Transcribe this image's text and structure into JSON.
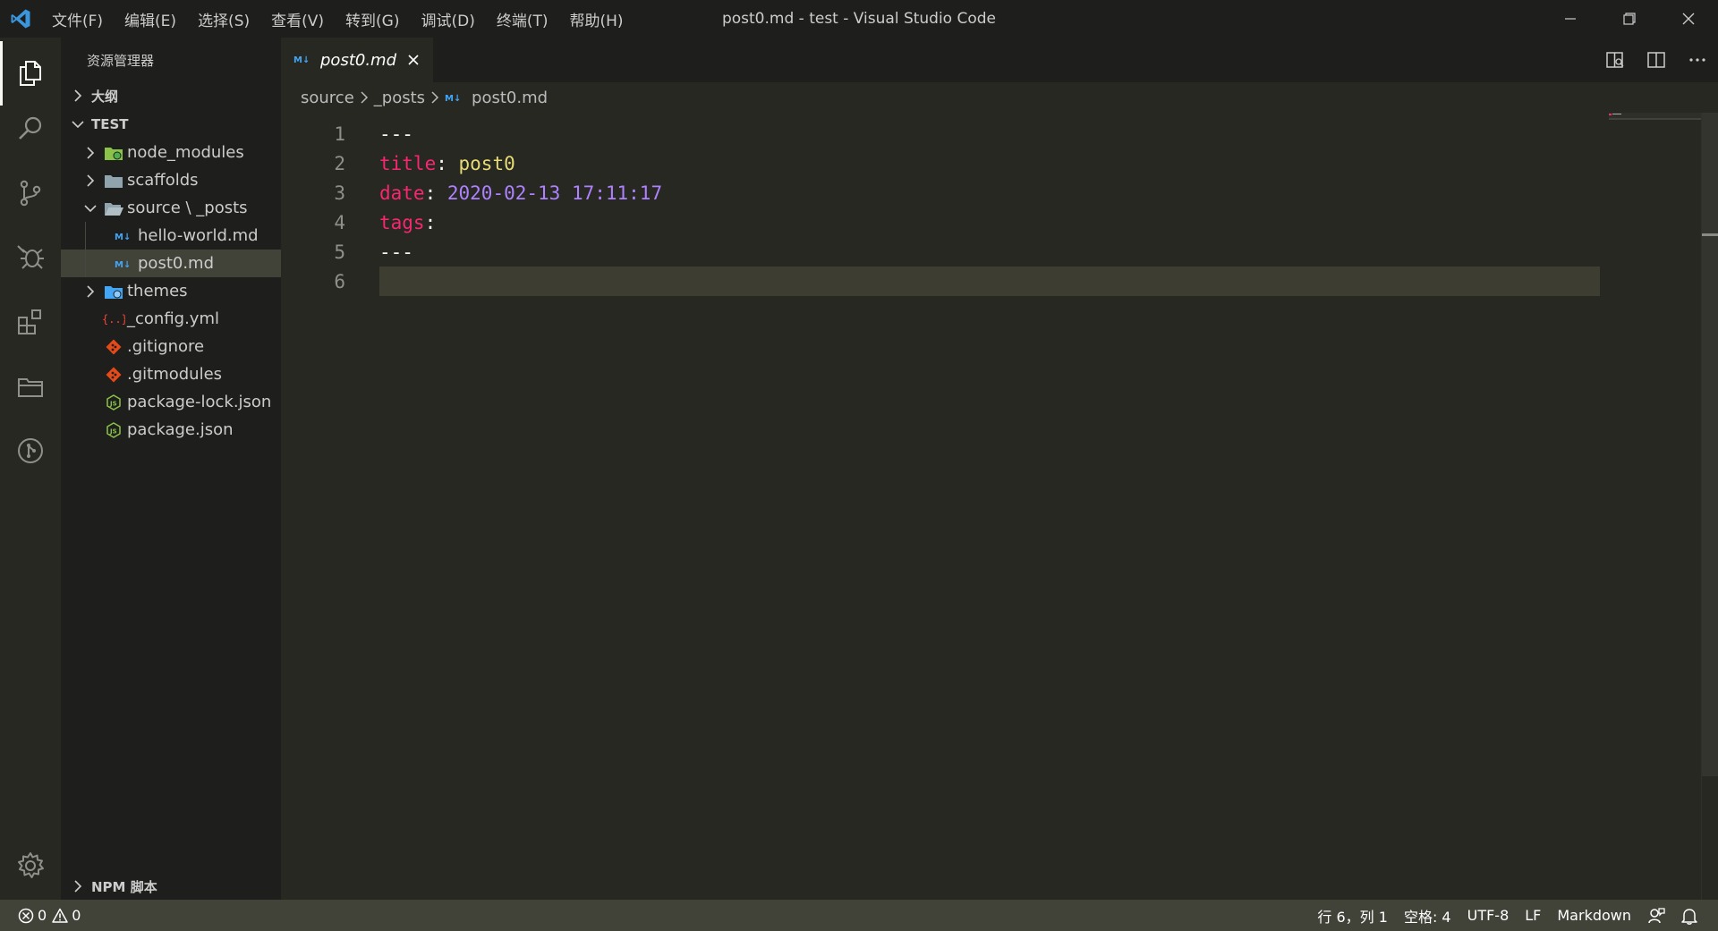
{
  "titlebar": {
    "menu": [
      "文件(F)",
      "编辑(E)",
      "选择(S)",
      "查看(V)",
      "转到(G)",
      "调试(D)",
      "终端(T)",
      "帮助(H)"
    ],
    "window_title": "post0.md - test - Visual Studio Code"
  },
  "sidebar": {
    "title": "资源管理器",
    "outline_label": "大纲",
    "workspace_label": "TEST",
    "tree": [
      {
        "label": "node_modules",
        "kind": "folder",
        "icon": "folder-node-icon",
        "expanded": false
      },
      {
        "label": "scaffolds",
        "kind": "folder",
        "icon": "folder-icon",
        "expanded": false
      },
      {
        "label": "source \\ _posts",
        "kind": "folder",
        "icon": "folder-open-icon",
        "expanded": true
      },
      {
        "label": "hello-world.md",
        "kind": "file",
        "icon": "markdown-icon"
      },
      {
        "label": "post0.md",
        "kind": "file",
        "icon": "markdown-icon",
        "selected": true
      },
      {
        "label": "themes",
        "kind": "folder",
        "icon": "folder-theme-icon",
        "expanded": false
      },
      {
        "label": "_config.yml",
        "kind": "file",
        "icon": "yaml-icon"
      },
      {
        "label": ".gitignore",
        "kind": "file",
        "icon": "git-icon"
      },
      {
        "label": ".gitmodules",
        "kind": "file",
        "icon": "git-icon"
      },
      {
        "label": "package-lock.json",
        "kind": "file",
        "icon": "nodejs-icon"
      },
      {
        "label": "package.json",
        "kind": "file",
        "icon": "nodejs-icon"
      }
    ],
    "npm_label": "NPM 脚本"
  },
  "tabs": [
    {
      "label": "post0.md",
      "icon": "markdown-icon",
      "active": true
    }
  ],
  "breadcrumb": {
    "items": [
      "source",
      "_posts",
      "post0.md"
    ]
  },
  "editor": {
    "lines": [
      {
        "num": "1",
        "parts": [
          {
            "t": "---",
            "c": "dash"
          }
        ]
      },
      {
        "num": "2",
        "parts": [
          {
            "t": "title",
            "c": "key"
          },
          {
            "t": ": ",
            "c": "punc"
          },
          {
            "t": "post0",
            "c": "str"
          }
        ]
      },
      {
        "num": "3",
        "parts": [
          {
            "t": "date",
            "c": "key"
          },
          {
            "t": ": ",
            "c": "punc"
          },
          {
            "t": "2020-02-13 17:11:17",
            "c": "num"
          }
        ]
      },
      {
        "num": "4",
        "parts": [
          {
            "t": "tags",
            "c": "key"
          },
          {
            "t": ":",
            "c": "punc"
          }
        ]
      },
      {
        "num": "5",
        "parts": [
          {
            "t": "---",
            "c": "dash"
          }
        ]
      },
      {
        "num": "6",
        "parts": [],
        "current": true
      }
    ]
  },
  "statusbar": {
    "errors": "0",
    "warnings": "0",
    "position": "行 6，列 1",
    "spaces": "空格: 4",
    "encoding": "UTF-8",
    "eol": "LF",
    "language": "Markdown"
  },
  "colors": {
    "key": "#f92672",
    "string": "#e6db74",
    "number": "#ae81ff",
    "background": "#272822",
    "sidebar": "#1e1f1c",
    "statusbar": "#414339"
  }
}
